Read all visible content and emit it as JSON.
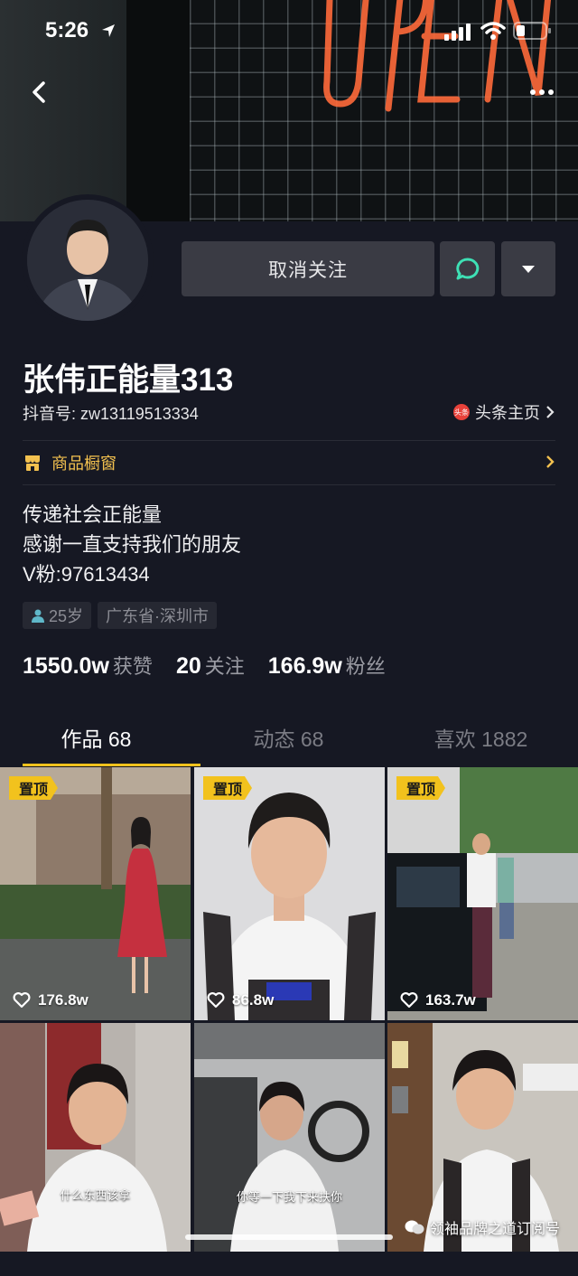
{
  "status_bar": {
    "time": "5:26"
  },
  "profile": {
    "unfollow_label": "取消关注",
    "name": "张伟正能量313",
    "douyin_id": "抖音号: zw13119513334",
    "toutiao_link": "头条主页",
    "toutiao_badge": "头条",
    "shop_label": "商品橱窗",
    "bio_lines": [
      "传递社会正能量",
      "感谢一直支持我们的朋友",
      "V粉:97613434"
    ],
    "tags": {
      "age": "25岁",
      "location": "广东省·深圳市"
    }
  },
  "stats": [
    {
      "num": "1550.0w",
      "label": "获赞"
    },
    {
      "num": "20",
      "label": "关注"
    },
    {
      "num": "166.9w",
      "label": "粉丝"
    }
  ],
  "tabs": [
    {
      "label": "作品 68",
      "active": true
    },
    {
      "label": "动态 68",
      "active": false
    },
    {
      "label": "喜欢 1882",
      "active": false
    }
  ],
  "videos": [
    {
      "pin": "置顶",
      "likes": "176.8w"
    },
    {
      "pin": "置顶",
      "likes": "86.8w"
    },
    {
      "pin": "置顶",
      "likes": "163.7w"
    },
    {
      "caption": "什么东西该拿"
    },
    {
      "caption": "你等一下我下来扶你"
    },
    {}
  ],
  "watermark": "领袖品牌之道订阅号",
  "colors": {
    "background": "#161823",
    "accent": "#f2c21d",
    "button": "#3a3b44",
    "message_icon": "#3ee0b5"
  }
}
